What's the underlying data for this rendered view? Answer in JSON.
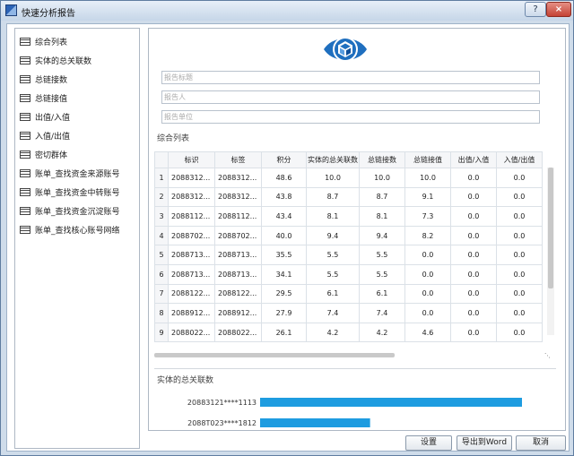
{
  "window": {
    "title": "快速分析报告",
    "help": "?",
    "close": "×"
  },
  "sidebar": {
    "items": [
      {
        "label": "综合列表"
      },
      {
        "label": "实体的总关联数"
      },
      {
        "label": "总链接数"
      },
      {
        "label": "总链接值"
      },
      {
        "label": "出值/入值"
      },
      {
        "label": "入值/出值"
      },
      {
        "label": "密切群体"
      },
      {
        "label": "账单_查找资金来源账号"
      },
      {
        "label": "账单_查找资金中转账号"
      },
      {
        "label": "账单_查找资金沉淀账号"
      },
      {
        "label": "账单_查找核心账号网络"
      }
    ]
  },
  "form": {
    "title_placeholder": "报告标题",
    "author_placeholder": "报告人",
    "unit_placeholder": "报告单位"
  },
  "table": {
    "section_title": "综合列表",
    "headers": [
      "标识",
      "标签",
      "积分",
      "实体的总关联数",
      "总链接数",
      "总链接值",
      "出值/入值",
      "入值/出值"
    ],
    "rows": [
      {
        "n": "1",
        "id": "2088312...",
        "tag": "2088312...",
        "score": "48.6",
        "assoc": "10.0",
        "links": "10.0",
        "linkval": "10.0",
        "outin": "0.0",
        "inout": "0.0"
      },
      {
        "n": "2",
        "id": "2088312...",
        "tag": "2088312...",
        "score": "43.8",
        "assoc": "8.7",
        "links": "8.7",
        "linkval": "9.1",
        "outin": "0.0",
        "inout": "0.0"
      },
      {
        "n": "3",
        "id": "2088112...",
        "tag": "2088112...",
        "score": "43.4",
        "assoc": "8.1",
        "links": "8.1",
        "linkval": "7.3",
        "outin": "0.0",
        "inout": "0.0"
      },
      {
        "n": "4",
        "id": "2088702...",
        "tag": "2088702...",
        "score": "40.0",
        "assoc": "9.4",
        "links": "9.4",
        "linkval": "8.2",
        "outin": "0.0",
        "inout": "0.0"
      },
      {
        "n": "5",
        "id": "2088713...",
        "tag": "2088713...",
        "score": "35.5",
        "assoc": "5.5",
        "links": "5.5",
        "linkval": "0.0",
        "outin": "0.0",
        "inout": "0.0"
      },
      {
        "n": "6",
        "id": "2088713...",
        "tag": "2088713...",
        "score": "34.1",
        "assoc": "5.5",
        "links": "5.5",
        "linkval": "0.0",
        "outin": "0.0",
        "inout": "0.0"
      },
      {
        "n": "7",
        "id": "2088122...",
        "tag": "2088122...",
        "score": "29.5",
        "assoc": "6.1",
        "links": "6.1",
        "linkval": "0.0",
        "outin": "0.0",
        "inout": "0.0"
      },
      {
        "n": "8",
        "id": "2088912...",
        "tag": "2088912...",
        "score": "27.9",
        "assoc": "7.4",
        "links": "7.4",
        "linkval": "0.0",
        "outin": "0.0",
        "inout": "0.0"
      },
      {
        "n": "9",
        "id": "2088022...",
        "tag": "2088022...",
        "score": "26.1",
        "assoc": "4.2",
        "links": "4.2",
        "linkval": "4.6",
        "outin": "0.0",
        "inout": "0.0"
      }
    ]
  },
  "chart_data": {
    "type": "bar",
    "title": "实体的总关联数",
    "orientation": "horizontal",
    "categories": [
      "20883121****1113",
      "2088T023****1812"
    ],
    "values": [
      10.0,
      4.2
    ],
    "bar_color": "#1e9ce0"
  },
  "buttons": {
    "settings": "设置",
    "export": "导出到Word",
    "cancel": "取消"
  },
  "scroll_dots": "⋱"
}
